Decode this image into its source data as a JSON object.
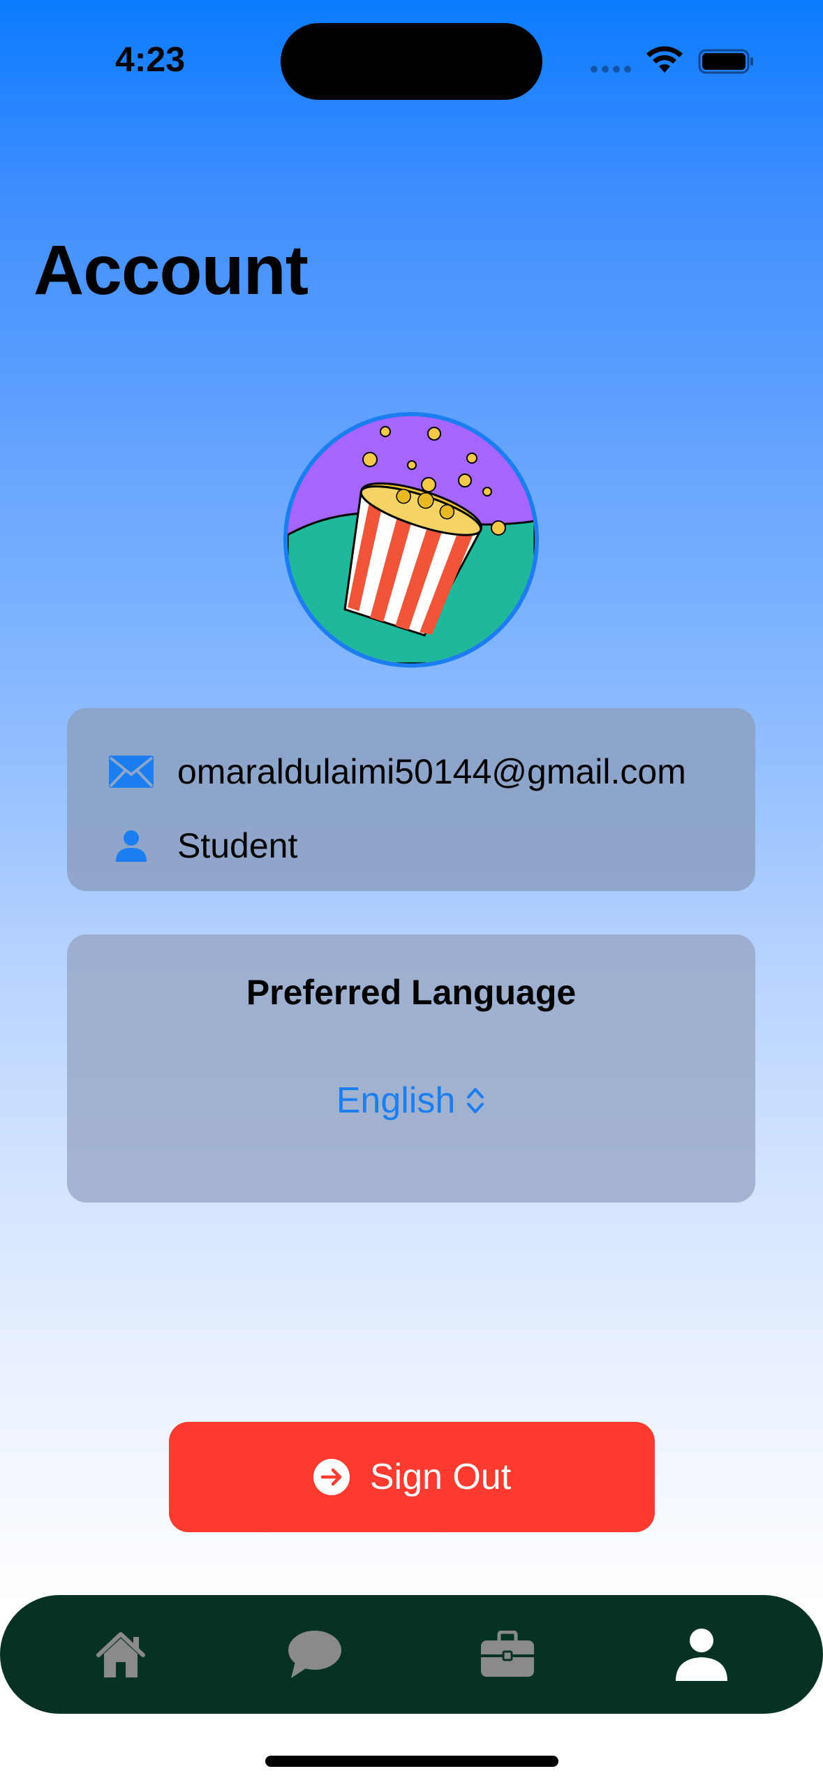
{
  "status_bar": {
    "time": "4:23"
  },
  "page": {
    "title": "Account"
  },
  "profile": {
    "avatar_icon": "popcorn-bucket-icon",
    "email": "omaraldulaimi50144@gmail.com",
    "role": "Student"
  },
  "language_card": {
    "title": "Preferred Language",
    "selected": "English"
  },
  "sign_out": {
    "label": "Sign Out",
    "icon": "arrow-right-circle-icon"
  },
  "tab_bar": {
    "items": [
      {
        "icon": "house-icon",
        "active": false
      },
      {
        "icon": "chat-bubble-icon",
        "active": false
      },
      {
        "icon": "briefcase-icon",
        "active": false
      },
      {
        "icon": "person-icon",
        "active": true
      }
    ]
  },
  "colors": {
    "accent": "#1a7df0",
    "destructive": "#ff3b30",
    "tab_bar_bg": "#053222",
    "tab_inactive": "#8a8a8a",
    "tab_active": "#ffffff"
  }
}
